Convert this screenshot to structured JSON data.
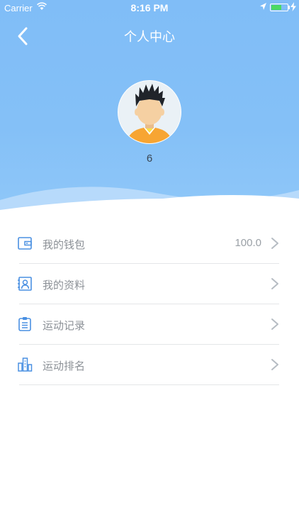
{
  "status_bar": {
    "carrier": "Carrier",
    "time": "8:16 PM"
  },
  "nav": {
    "title": "个人中心"
  },
  "profile": {
    "username": "6"
  },
  "menu": {
    "items": [
      {
        "label": "我的钱包",
        "value": "100.0",
        "icon": "wallet-icon"
      },
      {
        "label": "我的资料",
        "value": "",
        "icon": "profile-card-icon"
      },
      {
        "label": "运动记录",
        "value": "",
        "icon": "clipboard-icon"
      },
      {
        "label": "运动排名",
        "value": "",
        "icon": "ranking-buildings-icon"
      }
    ]
  },
  "colors": {
    "header": "#82bef7",
    "icon_blue": "#4a90e2",
    "chevron": "#b6bcc3"
  }
}
